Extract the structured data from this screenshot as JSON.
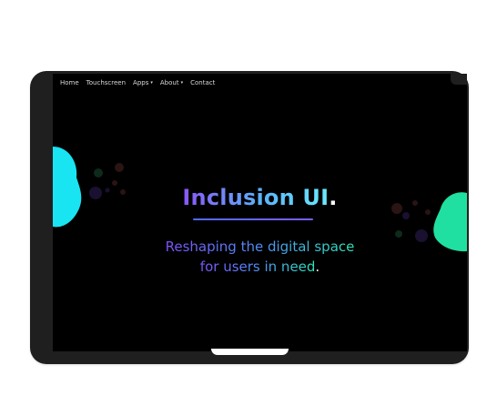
{
  "nav": {
    "items": [
      {
        "label": "Home",
        "dropdown": false
      },
      {
        "label": "Touchscreen",
        "dropdown": false
      },
      {
        "label": "Apps",
        "dropdown": true
      },
      {
        "label": "About",
        "dropdown": true
      },
      {
        "label": "Contact",
        "dropdown": false
      }
    ]
  },
  "hero": {
    "title": "Inclusion UI",
    "title_suffix": ".",
    "subtitle_line1": "Reshaping the digital space",
    "subtitle_line2": "for users in need",
    "subtitle_suffix": "."
  },
  "colors": {
    "background": "#000000",
    "frame": "#1f1f1f",
    "cyan_blob": "#19e4f2",
    "green_blob": "#1fe0a0",
    "accent_purple": "#7b52f7"
  },
  "icons": {
    "caret": "▾"
  }
}
